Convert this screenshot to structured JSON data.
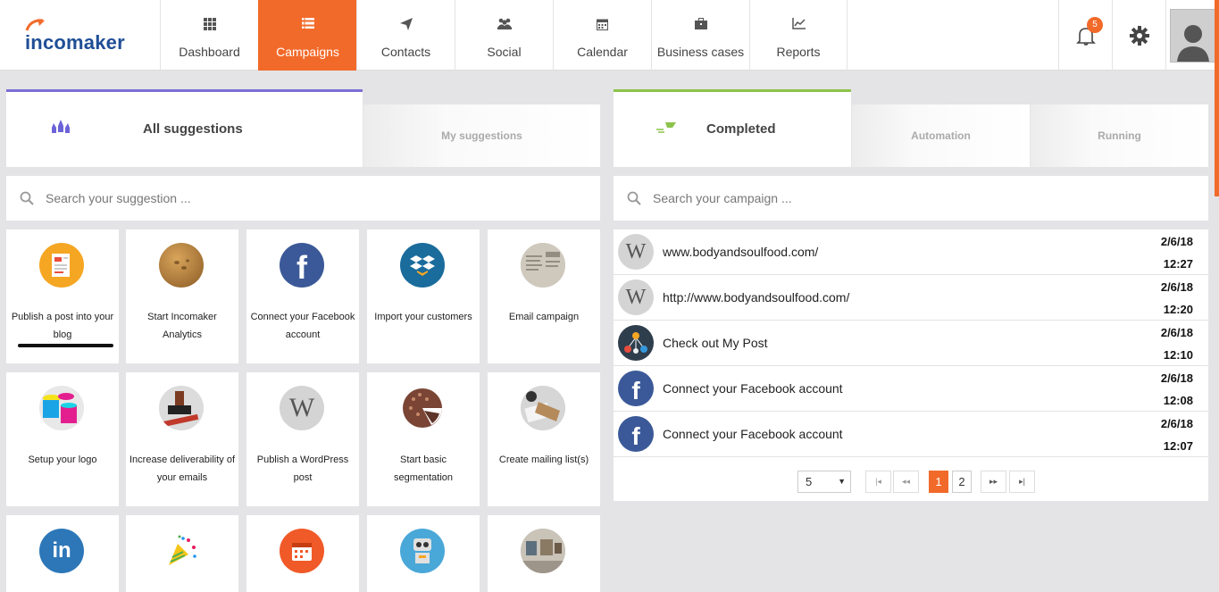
{
  "app": {
    "brand": "incomaker",
    "accent": "#f26a2a",
    "logo_blue": "#1f4e96"
  },
  "nav": [
    {
      "label": "Dashboard",
      "icon": "grid-icon"
    },
    {
      "label": "Campaigns",
      "icon": "list-icon",
      "active": true
    },
    {
      "label": "Contacts",
      "icon": "paper-plane-icon"
    },
    {
      "label": "Social",
      "icon": "users-icon"
    },
    {
      "label": "Calendar",
      "icon": "calendar-icon"
    },
    {
      "label": "Business cases",
      "icon": "briefcase-icon"
    },
    {
      "label": "Reports",
      "icon": "line-chart-icon"
    }
  ],
  "tools": {
    "notifications_count": "5"
  },
  "suggestions_tabs": {
    "all": "All suggestions",
    "mine": "My suggestions"
  },
  "campaign_tabs": {
    "completed": "Completed",
    "automation": "Automation",
    "running": "Running"
  },
  "search": {
    "suggestion_placeholder": "Search your suggestion ...",
    "campaign_placeholder": "Search your campaign ..."
  },
  "suggestions": [
    {
      "label": "Publish a post into your blog",
      "icon": "blog-icon"
    },
    {
      "label": "Start Incomaker Analytics",
      "icon": "analytics-icon"
    },
    {
      "label": "Connect your Facebook account",
      "icon": "facebook-icon"
    },
    {
      "label": "Import your customers",
      "icon": "dropbox-icon"
    },
    {
      "label": "Email campaign",
      "icon": "newspaper-icon"
    },
    {
      "label": "Setup your logo",
      "icon": "paint-buckets-icon"
    },
    {
      "label": "Increase deliverability of your emails",
      "icon": "stamp-icon"
    },
    {
      "label": "Publish a WordPress post",
      "icon": "wordpress-icon"
    },
    {
      "label": "Start basic segmentation",
      "icon": "segmentation-pie-icon"
    },
    {
      "label": "Create mailing list(s)",
      "icon": "mailing-icon"
    },
    {
      "label": "",
      "icon": "linkedin-icon"
    },
    {
      "label": "",
      "icon": "party-popper-icon"
    },
    {
      "label": "",
      "icon": "calendar-icon"
    },
    {
      "label": "",
      "icon": "robot-icon"
    },
    {
      "label": "",
      "icon": "gallery-icon"
    }
  ],
  "campaigns": [
    {
      "name": "www.bodyandsoulfood.com/",
      "date": "2/6/18",
      "time": "12:27",
      "icon": "wordpress-icon"
    },
    {
      "name": "http://www.bodyandsoulfood.com/",
      "date": "2/6/18",
      "time": "12:20",
      "icon": "wordpress-icon"
    },
    {
      "name": "Check out My Post",
      "date": "2/6/18",
      "time": "12:10",
      "icon": "network-icon"
    },
    {
      "name": "Connect your Facebook account",
      "date": "2/6/18",
      "time": "12:08",
      "icon": "facebook-icon"
    },
    {
      "name": "Connect your Facebook account",
      "date": "2/6/18",
      "time": "12:07",
      "icon": "facebook-icon"
    }
  ],
  "pager": {
    "page_size": "5",
    "pages": [
      "1",
      "2"
    ],
    "current": "1",
    "first": "|◂",
    "prev": "◂◂",
    "next": "▸▸",
    "last": "▸|"
  }
}
